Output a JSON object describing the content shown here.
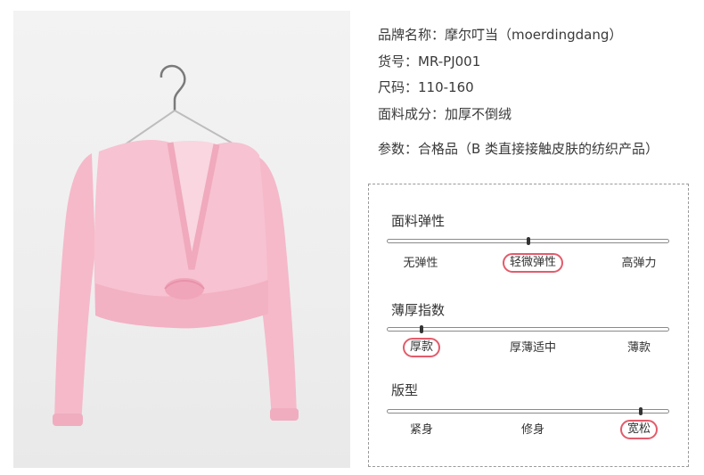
{
  "product_info": {
    "brand": "品牌名称：摩尔叮当（moerdingdang）",
    "item_no": "货号：MR-PJ001",
    "size": "尺码：110-160",
    "material": "面料成分：加厚不倒绒",
    "params": "参数：合格品（B 类直接接触皮肤的纺织产品）"
  },
  "attributes": [
    {
      "title": "面料弹性",
      "options": [
        "无弹性",
        "轻微弹性",
        "高弹力"
      ],
      "selected": "轻微弹性",
      "level": 0.5
    },
    {
      "title": "薄厚指数",
      "options": [
        "厚款",
        "厚薄适中",
        "薄款"
      ],
      "selected": "厚款",
      "level": 0.12
    },
    {
      "title": "版型",
      "options": [
        "紧身",
        "修身",
        "宽松"
      ],
      "selected": "宽松",
      "level": 0.9
    }
  ],
  "colors": {
    "highlight": "#e35b6a",
    "garment": "#f7c2d1"
  }
}
